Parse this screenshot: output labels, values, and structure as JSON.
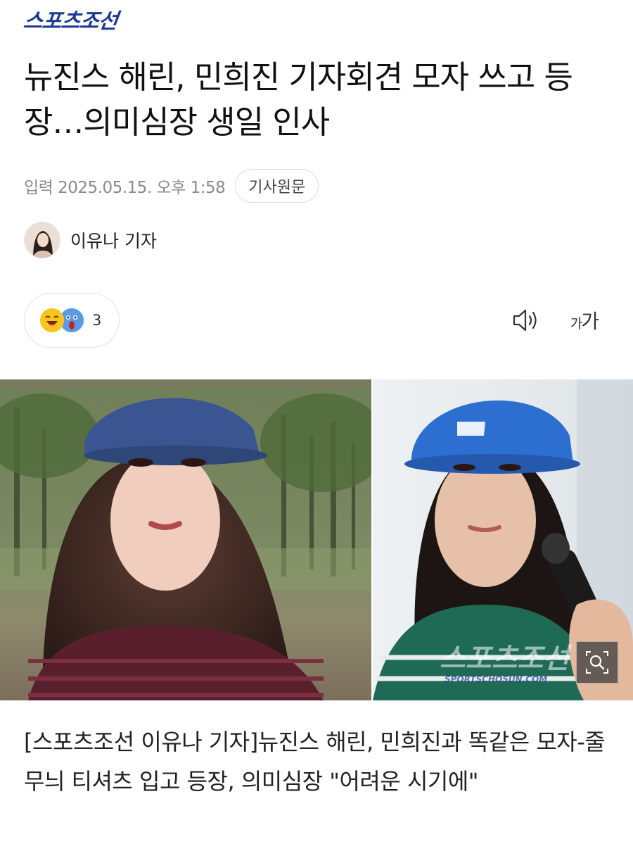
{
  "brand": {
    "logo_text": "스포츠조선",
    "color": "#1c3a8f"
  },
  "article": {
    "title": "뉴진스 해린, 민희진 기자회견 모자 쓰고 등장…의미심장 생일 인사",
    "date": "입력 2025.05.15. 오후 1:58",
    "original_link_label": "기사원문",
    "author": "이유나 기자",
    "reactions": {
      "count": "3",
      "icons": [
        "grinning-face-icon",
        "shocked-face-icon"
      ]
    },
    "tools": {
      "speaker_icon": "speaker-icon",
      "font_small": "가",
      "font_large": "가"
    },
    "photo": {
      "watermark_text": "스포츠조선",
      "watermark_url": "SPORTSCHOSUN.COM",
      "zoom_icon": "magnifier-icon"
    },
    "caption": "[스포츠조선 이유나 기자]뉴진스 해린, 민희진과 똑같은 모자-줄무늬 티셔츠 입고 등장, 의미심장 \"어려운 시기에\""
  }
}
